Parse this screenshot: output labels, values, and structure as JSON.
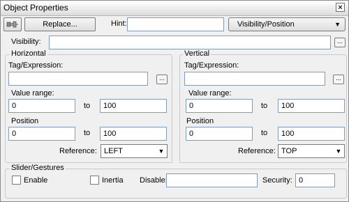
{
  "window": {
    "title": "Object Properties"
  },
  "toolbar": {
    "pin_icon": "pin-icon",
    "replace_label": "Replace...",
    "hint_label": "Hint:",
    "hint_value": "",
    "mode_select": "Visibility/Position"
  },
  "visibility": {
    "label": "Visibility:",
    "value": "",
    "browse": "..."
  },
  "horizontal": {
    "title": "Horizontal",
    "tag_label": "Tag/Expression:",
    "tag_value": "",
    "browse": "...",
    "value_range_label": "Value range:",
    "range_from": "0",
    "range_to": "100",
    "to_label": "to",
    "position_label": "Position",
    "pos_from": "0",
    "pos_to": "100",
    "pos_to_label": "to",
    "reference_label": "Reference:",
    "reference_value": "LEFT"
  },
  "vertical": {
    "title": "Vertical",
    "tag_label": "Tag/Expression:",
    "tag_value": "",
    "browse": "...",
    "value_range_label": "Value range:",
    "range_from": "0",
    "range_to": "100",
    "to_label": "to",
    "position_label": "Position",
    "pos_from": "0",
    "pos_to": "100",
    "pos_to_label": "to",
    "reference_label": "Reference:",
    "reference_value": "TOP"
  },
  "slider": {
    "title": "Slider/Gestures",
    "enable_label": "Enable",
    "enable_checked": false,
    "inertia_label": "Inertia",
    "inertia_checked": false,
    "disable_label": "Disable:",
    "disable_value": "",
    "security_label": "Security:",
    "security_value": "0"
  }
}
